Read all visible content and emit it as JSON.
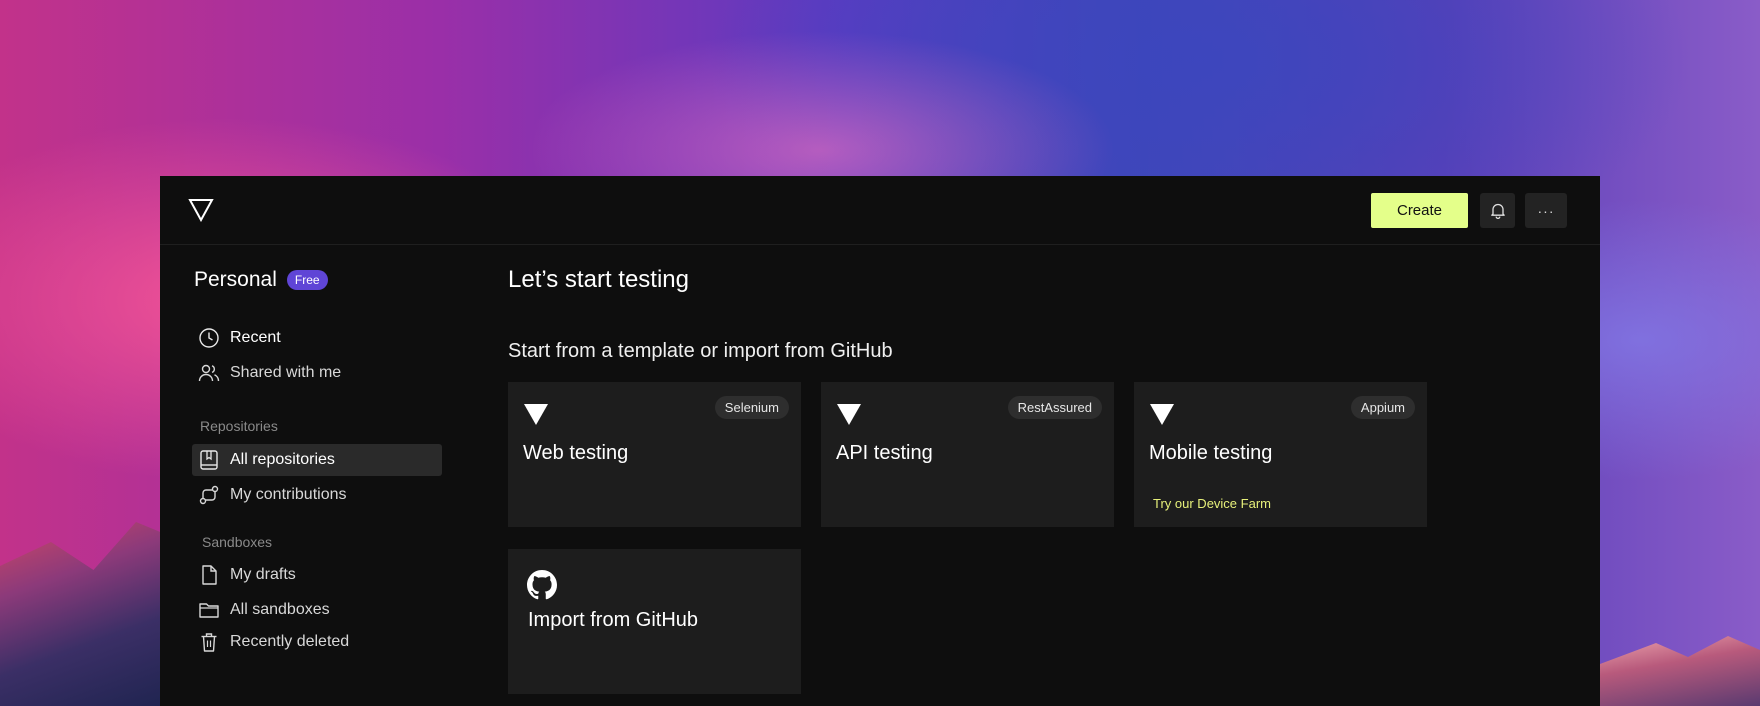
{
  "header": {
    "create_label": "Create",
    "more_label": "···"
  },
  "sidebar": {
    "workspace": "Personal",
    "plan_badge": "Free",
    "top_items": [
      {
        "label": "Recent",
        "icon": "clock-icon"
      },
      {
        "label": "Shared with me",
        "icon": "users-icon"
      }
    ],
    "repositories_label": "Repositories",
    "repositories_items": [
      {
        "label": "All repositories",
        "icon": "book-icon",
        "active": true
      },
      {
        "label": "My contributions",
        "icon": "git-branch-icon"
      }
    ],
    "sandboxes_label": "Sandboxes",
    "sandboxes_items": [
      {
        "label": "My drafts",
        "icon": "file-icon"
      },
      {
        "label": "All sandboxes",
        "icon": "folder-icon"
      },
      {
        "label": "Recently deleted",
        "icon": "trash-icon"
      }
    ]
  },
  "main": {
    "title": "Let’s start testing",
    "subtitle": "Start from a template or import from GitHub",
    "cards": [
      {
        "title": "Web testing",
        "tag": "Selenium",
        "icon": "triangle-logo-icon"
      },
      {
        "title": "API testing",
        "tag": "RestAssured",
        "icon": "triangle-logo-icon"
      },
      {
        "title": "Mobile testing",
        "tag": "Appium",
        "icon": "triangle-logo-icon",
        "extra": "Try our Device Farm"
      },
      {
        "title": "Import from GitHub",
        "icon": "github-icon"
      }
    ]
  },
  "colors": {
    "accent": "#e4ff8a",
    "badge": "#5f45d6",
    "window_bg": "#0e0e0e",
    "card_bg": "#1d1d1d",
    "link_yellow": "#e6f07a"
  }
}
